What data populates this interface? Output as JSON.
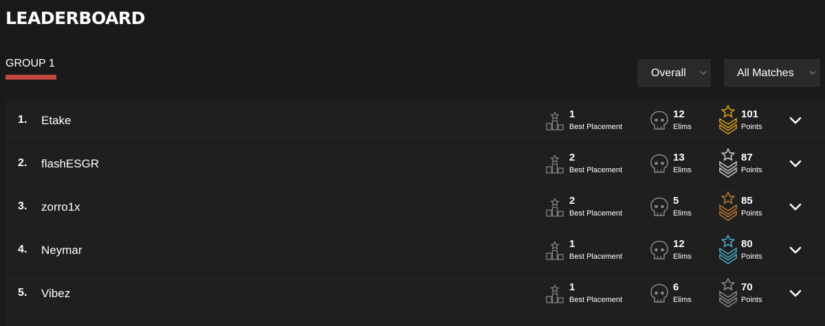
{
  "header": {
    "title": "LEADERBOARD"
  },
  "group_tab": {
    "label": "GROUP 1",
    "accent": "#c0483d"
  },
  "filters": {
    "scope": {
      "selected": "Overall"
    },
    "matches": {
      "selected": "All Matches"
    }
  },
  "labels": {
    "placement": "Best Placement",
    "elims": "Elims",
    "points": "Points"
  },
  "rows": [
    {
      "rank": "1.",
      "name": "Etake",
      "placement": "1",
      "elims": "12",
      "points": "101",
      "tier_color": "#d4a017"
    },
    {
      "rank": "2.",
      "name": "flashESGR",
      "placement": "2",
      "elims": "13",
      "points": "87",
      "tier_color": "#c8c8c8"
    },
    {
      "rank": "3.",
      "name": "zorro1x",
      "placement": "2",
      "elims": "5",
      "points": "85",
      "tier_color": "#b8762f"
    },
    {
      "rank": "4.",
      "name": "Neymar",
      "placement": "1",
      "elims": "12",
      "points": "80",
      "tier_color": "#4aa8c8"
    },
    {
      "rank": "5.",
      "name": "Vibez",
      "placement": "1",
      "elims": "6",
      "points": "70",
      "tier_color": "#8a8a8a"
    }
  ],
  "icons": {
    "placement": "podium-star-icon",
    "elims": "skull-icon",
    "points": "chevron-rank-star-icon",
    "expand": "chevron-down-icon"
  }
}
